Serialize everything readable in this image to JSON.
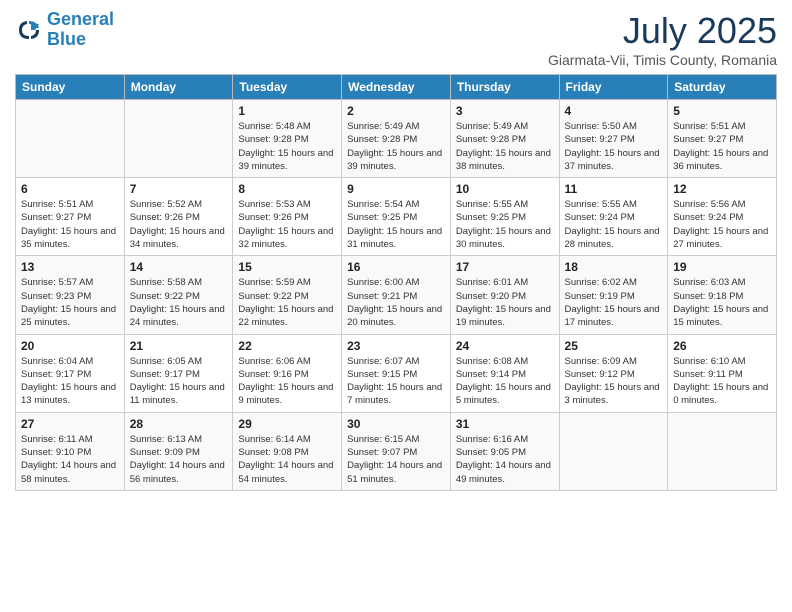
{
  "header": {
    "logo_line1": "General",
    "logo_line2": "Blue",
    "month": "July 2025",
    "location": "Giarmata-Vii, Timis County, Romania"
  },
  "weekdays": [
    "Sunday",
    "Monday",
    "Tuesday",
    "Wednesday",
    "Thursday",
    "Friday",
    "Saturday"
  ],
  "weeks": [
    [
      {
        "day": "",
        "info": ""
      },
      {
        "day": "",
        "info": ""
      },
      {
        "day": "1",
        "info": "Sunrise: 5:48 AM\nSunset: 9:28 PM\nDaylight: 15 hours and 39 minutes."
      },
      {
        "day": "2",
        "info": "Sunrise: 5:49 AM\nSunset: 9:28 PM\nDaylight: 15 hours and 39 minutes."
      },
      {
        "day": "3",
        "info": "Sunrise: 5:49 AM\nSunset: 9:28 PM\nDaylight: 15 hours and 38 minutes."
      },
      {
        "day": "4",
        "info": "Sunrise: 5:50 AM\nSunset: 9:27 PM\nDaylight: 15 hours and 37 minutes."
      },
      {
        "day": "5",
        "info": "Sunrise: 5:51 AM\nSunset: 9:27 PM\nDaylight: 15 hours and 36 minutes."
      }
    ],
    [
      {
        "day": "6",
        "info": "Sunrise: 5:51 AM\nSunset: 9:27 PM\nDaylight: 15 hours and 35 minutes."
      },
      {
        "day": "7",
        "info": "Sunrise: 5:52 AM\nSunset: 9:26 PM\nDaylight: 15 hours and 34 minutes."
      },
      {
        "day": "8",
        "info": "Sunrise: 5:53 AM\nSunset: 9:26 PM\nDaylight: 15 hours and 32 minutes."
      },
      {
        "day": "9",
        "info": "Sunrise: 5:54 AM\nSunset: 9:25 PM\nDaylight: 15 hours and 31 minutes."
      },
      {
        "day": "10",
        "info": "Sunrise: 5:55 AM\nSunset: 9:25 PM\nDaylight: 15 hours and 30 minutes."
      },
      {
        "day": "11",
        "info": "Sunrise: 5:55 AM\nSunset: 9:24 PM\nDaylight: 15 hours and 28 minutes."
      },
      {
        "day": "12",
        "info": "Sunrise: 5:56 AM\nSunset: 9:24 PM\nDaylight: 15 hours and 27 minutes."
      }
    ],
    [
      {
        "day": "13",
        "info": "Sunrise: 5:57 AM\nSunset: 9:23 PM\nDaylight: 15 hours and 25 minutes."
      },
      {
        "day": "14",
        "info": "Sunrise: 5:58 AM\nSunset: 9:22 PM\nDaylight: 15 hours and 24 minutes."
      },
      {
        "day": "15",
        "info": "Sunrise: 5:59 AM\nSunset: 9:22 PM\nDaylight: 15 hours and 22 minutes."
      },
      {
        "day": "16",
        "info": "Sunrise: 6:00 AM\nSunset: 9:21 PM\nDaylight: 15 hours and 20 minutes."
      },
      {
        "day": "17",
        "info": "Sunrise: 6:01 AM\nSunset: 9:20 PM\nDaylight: 15 hours and 19 minutes."
      },
      {
        "day": "18",
        "info": "Sunrise: 6:02 AM\nSunset: 9:19 PM\nDaylight: 15 hours and 17 minutes."
      },
      {
        "day": "19",
        "info": "Sunrise: 6:03 AM\nSunset: 9:18 PM\nDaylight: 15 hours and 15 minutes."
      }
    ],
    [
      {
        "day": "20",
        "info": "Sunrise: 6:04 AM\nSunset: 9:17 PM\nDaylight: 15 hours and 13 minutes."
      },
      {
        "day": "21",
        "info": "Sunrise: 6:05 AM\nSunset: 9:17 PM\nDaylight: 15 hours and 11 minutes."
      },
      {
        "day": "22",
        "info": "Sunrise: 6:06 AM\nSunset: 9:16 PM\nDaylight: 15 hours and 9 minutes."
      },
      {
        "day": "23",
        "info": "Sunrise: 6:07 AM\nSunset: 9:15 PM\nDaylight: 15 hours and 7 minutes."
      },
      {
        "day": "24",
        "info": "Sunrise: 6:08 AM\nSunset: 9:14 PM\nDaylight: 15 hours and 5 minutes."
      },
      {
        "day": "25",
        "info": "Sunrise: 6:09 AM\nSunset: 9:12 PM\nDaylight: 15 hours and 3 minutes."
      },
      {
        "day": "26",
        "info": "Sunrise: 6:10 AM\nSunset: 9:11 PM\nDaylight: 15 hours and 0 minutes."
      }
    ],
    [
      {
        "day": "27",
        "info": "Sunrise: 6:11 AM\nSunset: 9:10 PM\nDaylight: 14 hours and 58 minutes."
      },
      {
        "day": "28",
        "info": "Sunrise: 6:13 AM\nSunset: 9:09 PM\nDaylight: 14 hours and 56 minutes."
      },
      {
        "day": "29",
        "info": "Sunrise: 6:14 AM\nSunset: 9:08 PM\nDaylight: 14 hours and 54 minutes."
      },
      {
        "day": "30",
        "info": "Sunrise: 6:15 AM\nSunset: 9:07 PM\nDaylight: 14 hours and 51 minutes."
      },
      {
        "day": "31",
        "info": "Sunrise: 6:16 AM\nSunset: 9:05 PM\nDaylight: 14 hours and 49 minutes."
      },
      {
        "day": "",
        "info": ""
      },
      {
        "day": "",
        "info": ""
      }
    ]
  ]
}
